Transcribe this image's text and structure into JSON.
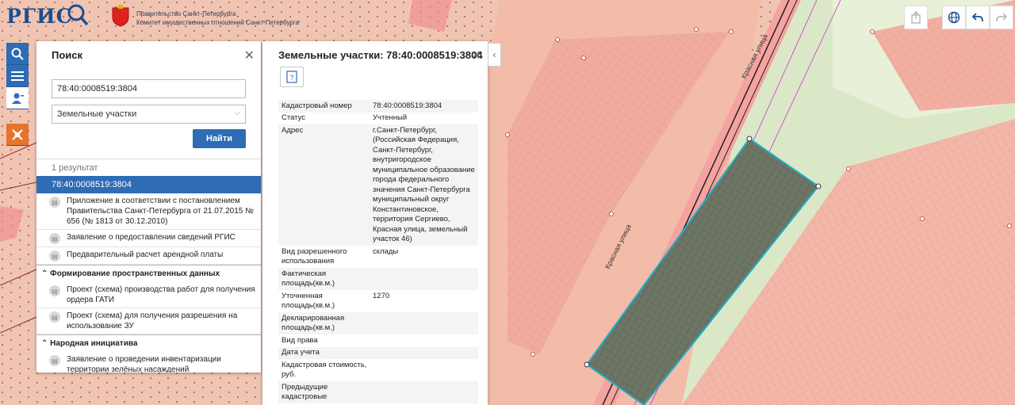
{
  "header": {
    "logo": "РГИС",
    "gov_line1": "Правительство Санкт-Петербурга",
    "gov_line2": "Комитет имущественных отношений Санкт-Петербурга"
  },
  "map": {
    "street1": "Красная улица",
    "street2": "Красная улица"
  },
  "search": {
    "title": "Поиск",
    "query": "78:40:0008519:3804",
    "category": "Земельные участки",
    "find_label": "Найти",
    "result_count": "1 результат",
    "result_item": "78:40:0008519:3804",
    "items": [
      "Приложение в соответствии с постановлением Правительства Санкт-Петербурга от 21.07.2015 № 656 (№ 1813 от 30.12.2010)",
      "Заявление о предоставлении сведений РГИС",
      "Предварительный расчет арендной платы"
    ],
    "section1": "Формирование пространственных данных",
    "section1_items": [
      "Проект (схема) производства работ для получения ордера ГАТИ",
      "Проект (схема) для получения разрешения на использование ЗУ"
    ],
    "section2": "Народная инициатива",
    "section2_items": [
      "Заявление о проведении инвентаризации территории зелёных насаждений"
    ]
  },
  "info": {
    "title": "Земельные участки: 78:40:0008519:3804",
    "rows": [
      {
        "k": "Кадастровый номер",
        "v": "78:40:0008519:3804"
      },
      {
        "k": "Статус",
        "v": "Учтенный"
      },
      {
        "k": "Адрес",
        "v": "г.Санкт-Петербург, (Российская Федерация, Санкт-Петербург, внутригородское муниципальное образование города федерального значения Санкт-Петербурга муниципальный округ Константиновское, территория Сергиево, Красная улица, земельный участок 46)"
      },
      {
        "k": "Вид разрешенного использования",
        "v": "склады"
      },
      {
        "k": "Фактическая площадь(кв.м.)",
        "v": ""
      },
      {
        "k": "Уточненная площадь(кв.м.)",
        "v": "1270"
      },
      {
        "k": "Декларированная площадь(кв.м.)",
        "v": ""
      },
      {
        "k": "Вид права",
        "v": ""
      },
      {
        "k": "Дата учета",
        "v": ""
      },
      {
        "k": "Кадастровая стоимость, руб.",
        "v": ""
      },
      {
        "k": "Предыдущие кадастровые",
        "v": ""
      }
    ]
  },
  "colors": {
    "accent": "#2e6cb5",
    "parcel_fill": "#f2b5a6",
    "selected": "#6f7a6a",
    "selected_border": "#1fb0c8"
  }
}
